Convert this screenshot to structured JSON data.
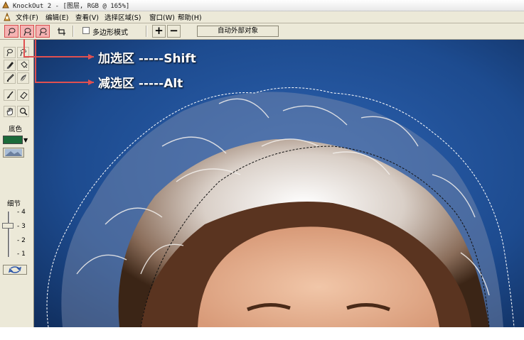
{
  "window": {
    "title": "KnockOut 2 - [图层, RGB @ 165%]"
  },
  "menu": {
    "items": [
      {
        "label": "文件",
        "key": "(F)"
      },
      {
        "label": "编辑",
        "key": "(E)"
      },
      {
        "label": "查看",
        "key": "(V)"
      },
      {
        "label": "选择区域",
        "key": "(S)"
      },
      {
        "label": "窗口",
        "key": "(W)"
      },
      {
        "label": "帮助",
        "key": "(H)"
      }
    ]
  },
  "toolbar": {
    "polygon_mode_label": "多边形模式",
    "plus_label": "+",
    "minus_label": "−",
    "auto_button_label": "自动外部对象"
  },
  "panel": {
    "fill_label": "底色",
    "fill_color": "#1b6b3a",
    "detail_label": "细节",
    "detail_ticks": [
      "4",
      "3",
      "2",
      "1"
    ],
    "detail_value": 3
  },
  "annotations": {
    "add_selection": "加选区 -----Shift",
    "subtract_selection": "减选区 -----Alt"
  },
  "colors": {
    "highlight": "#e05050",
    "background_blue": "#1a3c7a"
  }
}
